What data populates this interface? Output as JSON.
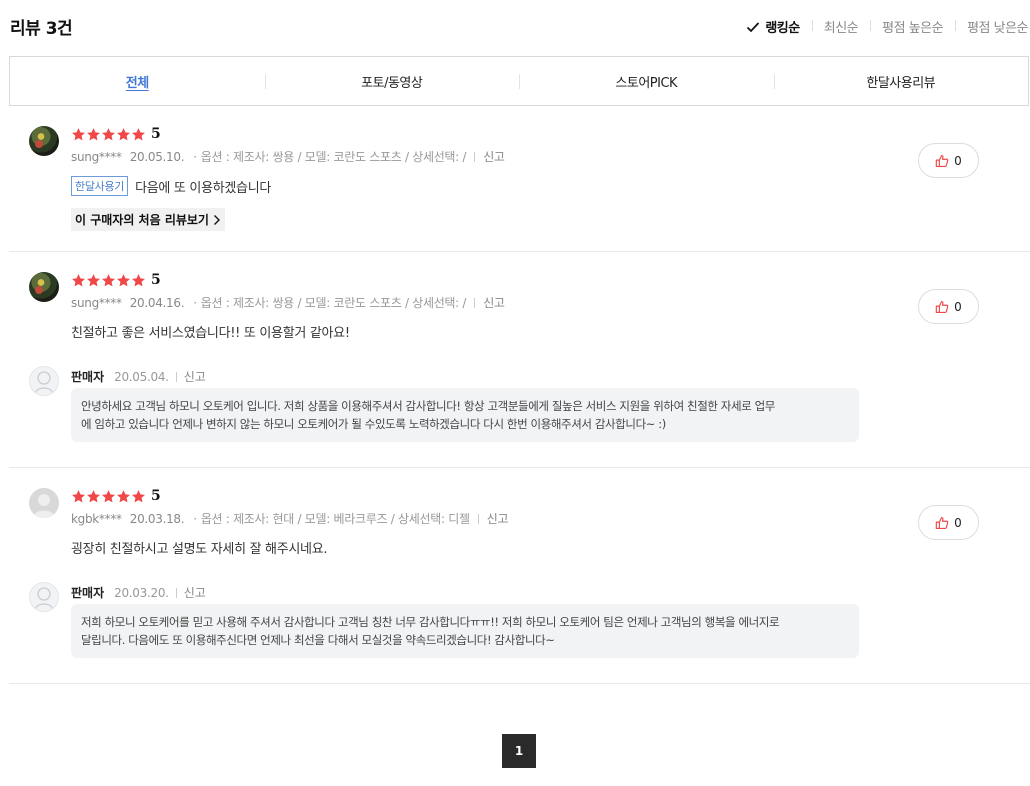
{
  "header": {
    "title": "리뷰 3건"
  },
  "sort": [
    {
      "label": "랭킹순",
      "active": true
    },
    {
      "label": "최신순",
      "active": false
    },
    {
      "label": "평점 높은순",
      "active": false
    },
    {
      "label": "평점 낮은순",
      "active": false
    }
  ],
  "tabs": [
    {
      "label": "전체",
      "active": true
    },
    {
      "label": "포토/동영상",
      "active": false
    },
    {
      "label": "스토어PICK",
      "active": false
    },
    {
      "label": "한달사용리뷰",
      "active": false
    }
  ],
  "reviews": [
    {
      "score": "5",
      "user": "sung****",
      "date": "20.05.10.",
      "option": "옵션 : 제조사: 쌍용 / 모델: 코란도 스포츠 / 상세선택: /",
      "report": "신고",
      "tag": "한달사용기",
      "text": "다음에 또 이용하겠습니다",
      "first_review_link": "이 구매자의 처음 리뷰보기",
      "likes": "0"
    },
    {
      "score": "5",
      "user": "sung****",
      "date": "20.04.16.",
      "option": "옵션 : 제조사: 쌍용 / 모델: 코란도 스포츠 / 상세선택: /",
      "report": "신고",
      "text": "친절하고 좋은 서비스였습니다!! 또 이용할거 같아요!",
      "likes": "0",
      "seller": {
        "name": "판매자",
        "date": "20.05.04.",
        "report": "신고",
        "reply_line1": "안녕하세요 고객님 하모니 오토케어 입니다. 저희 상품을 이용해주셔서 감사합니다! 항상 고객분들에게 질높은 서비스 지원을 위하여 친절한 자세로 업무",
        "reply_line2": "에 임하고 있습니다 언제나 변하지 않는 하모니 오토케어가 될 수있도록 노력하겠습니다 다시 한번 이용해주셔서 감사합니다~ :)"
      }
    },
    {
      "score": "5",
      "user": "kgbk****",
      "date": "20.03.18.",
      "option": "옵션 : 제조사: 현대 / 모델: 베라크루즈 / 상세선택: 디젤",
      "report": "신고",
      "text": "굉장히 친절하시고 설명도 자세히 잘 해주시네요.",
      "likes": "0",
      "seller": {
        "name": "판매자",
        "date": "20.03.20.",
        "report": "신고",
        "reply_line1": "저희 하모니 오토케어를 믿고 사용해 주셔서 감사합니다 고객님 칭찬 너무 감사합니다ㅠㅠ!! 저희 하모니 오토케어 팀은 언제나 고객님의 행복을 에너지로",
        "reply_line2": "달립니다. 다음에도 또 이용해주신다면 언제나 최선을 다해서 모실것을 약속드리겠습니다! 감사합니다~"
      }
    }
  ],
  "pagination": {
    "current": "1"
  },
  "colors": {
    "star": "#f04848",
    "active_tab": "#4277d6",
    "like_icon": "#f04848"
  },
  "icons": {
    "check": "check-icon",
    "star": "star-icon",
    "thumb": "thumbs-up-icon",
    "chevron": "chevron-right-icon"
  }
}
